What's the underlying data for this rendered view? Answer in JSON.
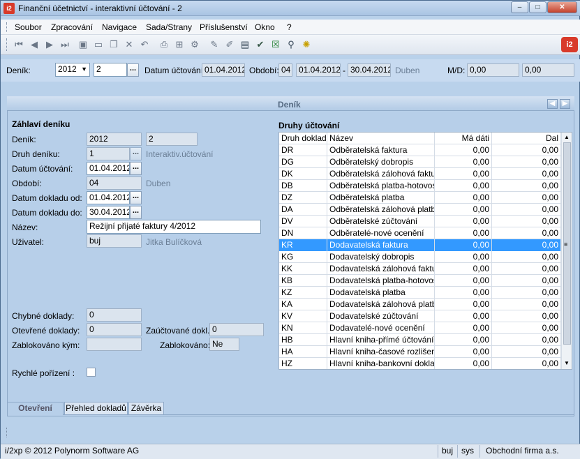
{
  "window": {
    "title": "Finanční účetnictví - interaktivní účtování - 2",
    "app_icon": "i2",
    "minimize": "–",
    "maximize": "□",
    "close": "✕"
  },
  "menu": [
    "Soubor",
    "Zpracování",
    "Navigace",
    "Sada/Strany",
    "Příslušenství",
    "Okno",
    "?"
  ],
  "header": {
    "denik_label": "Deník:",
    "year": "2012",
    "denik_no": "2",
    "datum_label": "Datum účtování:",
    "datum": "01.04.2012",
    "obdobi_label": "Období:",
    "obdobi": "04",
    "od": "01.04.2012",
    "dash": "-",
    "do": "30.04.2012",
    "month": "Duben",
    "md_label": "M/D:",
    "md1": "0,00",
    "md2": "0,00"
  },
  "panel": {
    "title": "Deník",
    "section_left": "Záhlaví deníku",
    "section_right": "Druhy účtování"
  },
  "form": {
    "denik_label": "Deník:",
    "denik_year": "2012",
    "denik_no": "2",
    "druh_label": "Druh deníku:",
    "druh_value": "1",
    "druh_desc": "Interaktiv.účtování",
    "datum_label": "Datum účtování:",
    "datum_value": "01.04.2012",
    "obdobi_label": "Období:",
    "obdobi_value": "04",
    "obdobi_desc": "Duben",
    "od_label": "Datum dokladu od:",
    "od_value": "01.04.2012",
    "do_label": "Datum dokladu do:",
    "do_value": "30.04.2012",
    "nazev_label": "Název:",
    "nazev_value": "Režijní přijaté faktury 4/2012",
    "uzivatel_label": "Uživatel:",
    "uzivatel_value": "buj",
    "uzivatel_desc": "Jitka Bulíčková",
    "chybne_label": "Chybné doklady:",
    "chybne_value": "0",
    "otevrene_label": "Otevřené doklady:",
    "otevrene_value": "0",
    "zauct_label": "Zaúčtované dokl.:",
    "zauct_value": "0",
    "blok_kym_label": "Zablokováno kým:",
    "blok_kym_value": "",
    "blok_label": "Zablokováno:",
    "blok_value": "Ne",
    "rychle_label": "Rychlé pořízení :"
  },
  "table": {
    "columns": [
      "Druh dokladu",
      "Název",
      "Má dáti",
      "Dal"
    ],
    "selected_index": 8,
    "rows": [
      [
        "DR",
        "Odběratelská faktura",
        "0,00",
        "0,00"
      ],
      [
        "DG",
        "Odběratelský dobropis",
        "0,00",
        "0,00"
      ],
      [
        "DK",
        "Odběratelská zálohová faktura",
        "0,00",
        "0,00"
      ],
      [
        "DB",
        "Odběratelská platba-hotovost",
        "0,00",
        "0,00"
      ],
      [
        "DZ",
        "Odběratelská platba",
        "0,00",
        "0,00"
      ],
      [
        "DA",
        "Odběratelská zálohová platba",
        "0,00",
        "0,00"
      ],
      [
        "DV",
        "Odběratelské zúčtování",
        "0,00",
        "0,00"
      ],
      [
        "DN",
        "Odběratelé-nové ocenění",
        "0,00",
        "0,00"
      ],
      [
        "KR",
        "Dodavatelská faktura",
        "0,00",
        "0,00"
      ],
      [
        "KG",
        "Dodavatelský dobropis",
        "0,00",
        "0,00"
      ],
      [
        "KK",
        "Dodavatelská zálohová faktura",
        "0,00",
        "0,00"
      ],
      [
        "KB",
        "Dodavatelská platba-hotovost",
        "0,00",
        "0,00"
      ],
      [
        "KZ",
        "Dodavatelská platba",
        "0,00",
        "0,00"
      ],
      [
        "KA",
        "Dodavatelská zálohová platba",
        "0,00",
        "0,00"
      ],
      [
        "KV",
        "Dodavatelské zúčtování",
        "0,00",
        "0,00"
      ],
      [
        "KN",
        "Dodavatelé-nové ocenění",
        "0,00",
        "0,00"
      ],
      [
        "HB",
        "Hlavní kniha-přímé účtování",
        "0,00",
        "0,00"
      ],
      [
        "HA",
        "Hlavní kniha-časové rozlišení",
        "0,00",
        "0,00"
      ],
      [
        "HZ",
        "Hlavní kniha-bankovní doklad",
        "0,00",
        "0,00"
      ]
    ]
  },
  "tabs": [
    "Otevření",
    "Přehled dokladů",
    "Závěrka"
  ],
  "status": {
    "copyright": "i/2xp © 2012 Polynorm Software AG",
    "user": "buj",
    "sys": "sys",
    "company": "Obchodní firma a.s."
  },
  "icons": [
    "first-icon",
    "prev-icon",
    "next-icon",
    "last-icon",
    "save-icon",
    "new-icon",
    "copy-icon",
    "delete-icon",
    "undo-icon",
    "print-icon",
    "tree-icon",
    "gear-icon",
    "edit-icon",
    "pen-icon",
    "calendar-icon",
    "check-icon",
    "excel-icon",
    "search-icon",
    "bulb-icon"
  ]
}
